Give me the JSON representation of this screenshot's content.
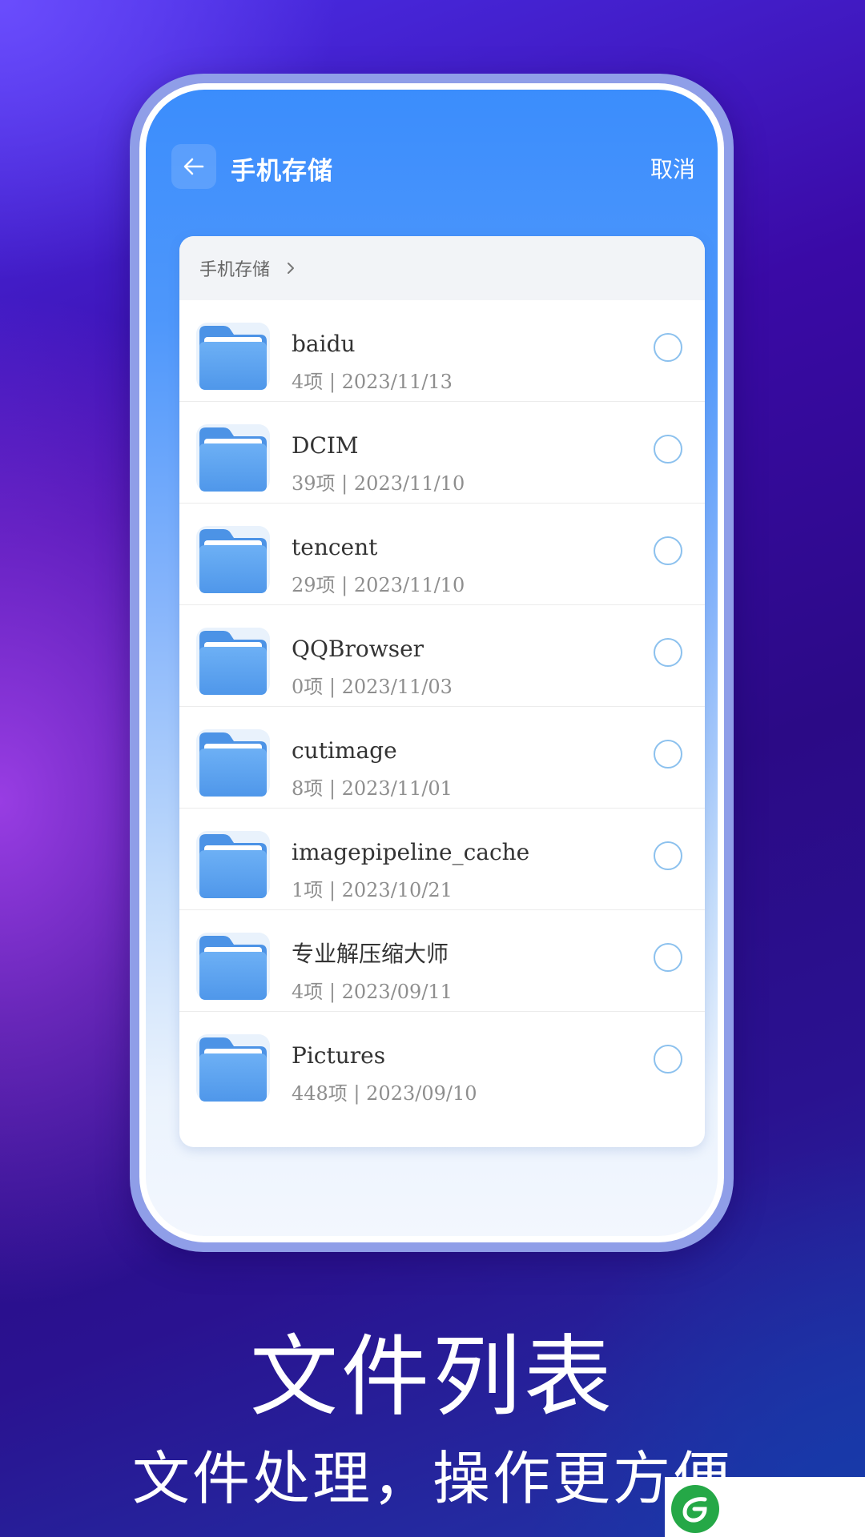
{
  "header": {
    "title": "手机存储",
    "cancel_label": "取消"
  },
  "breadcrumb": {
    "path": "手机存储"
  },
  "files": [
    {
      "name": "baidu",
      "meta": "4项 | 2023/11/13"
    },
    {
      "name": "DCIM",
      "meta": "39项 | 2023/11/10"
    },
    {
      "name": "tencent",
      "meta": "29项 | 2023/11/10"
    },
    {
      "name": "QQBrowser",
      "meta": "0项 | 2023/11/03"
    },
    {
      "name": "cutimage",
      "meta": "8项 | 2023/11/01"
    },
    {
      "name": "imagepipeline_cache",
      "meta": "1项 | 2023/10/21"
    },
    {
      "name": "专业解压缩大师",
      "meta": "4项 | 2023/09/11"
    },
    {
      "name": "Pictures",
      "meta": "448项 | 2023/09/10"
    }
  ],
  "promo": {
    "headline": "文件列表",
    "subline": "文件处理，操作更方便"
  },
  "icons": {
    "back": "arrow-left-icon",
    "chevron": "chevron-right-icon",
    "folder": "folder-icon",
    "radio": "radio-unchecked-icon",
    "logo": "leaf-logo-icon"
  },
  "colors": {
    "accent": "#3b8dfc",
    "folder": "#5aa2f0",
    "radio_border": "#8cc1ee"
  }
}
